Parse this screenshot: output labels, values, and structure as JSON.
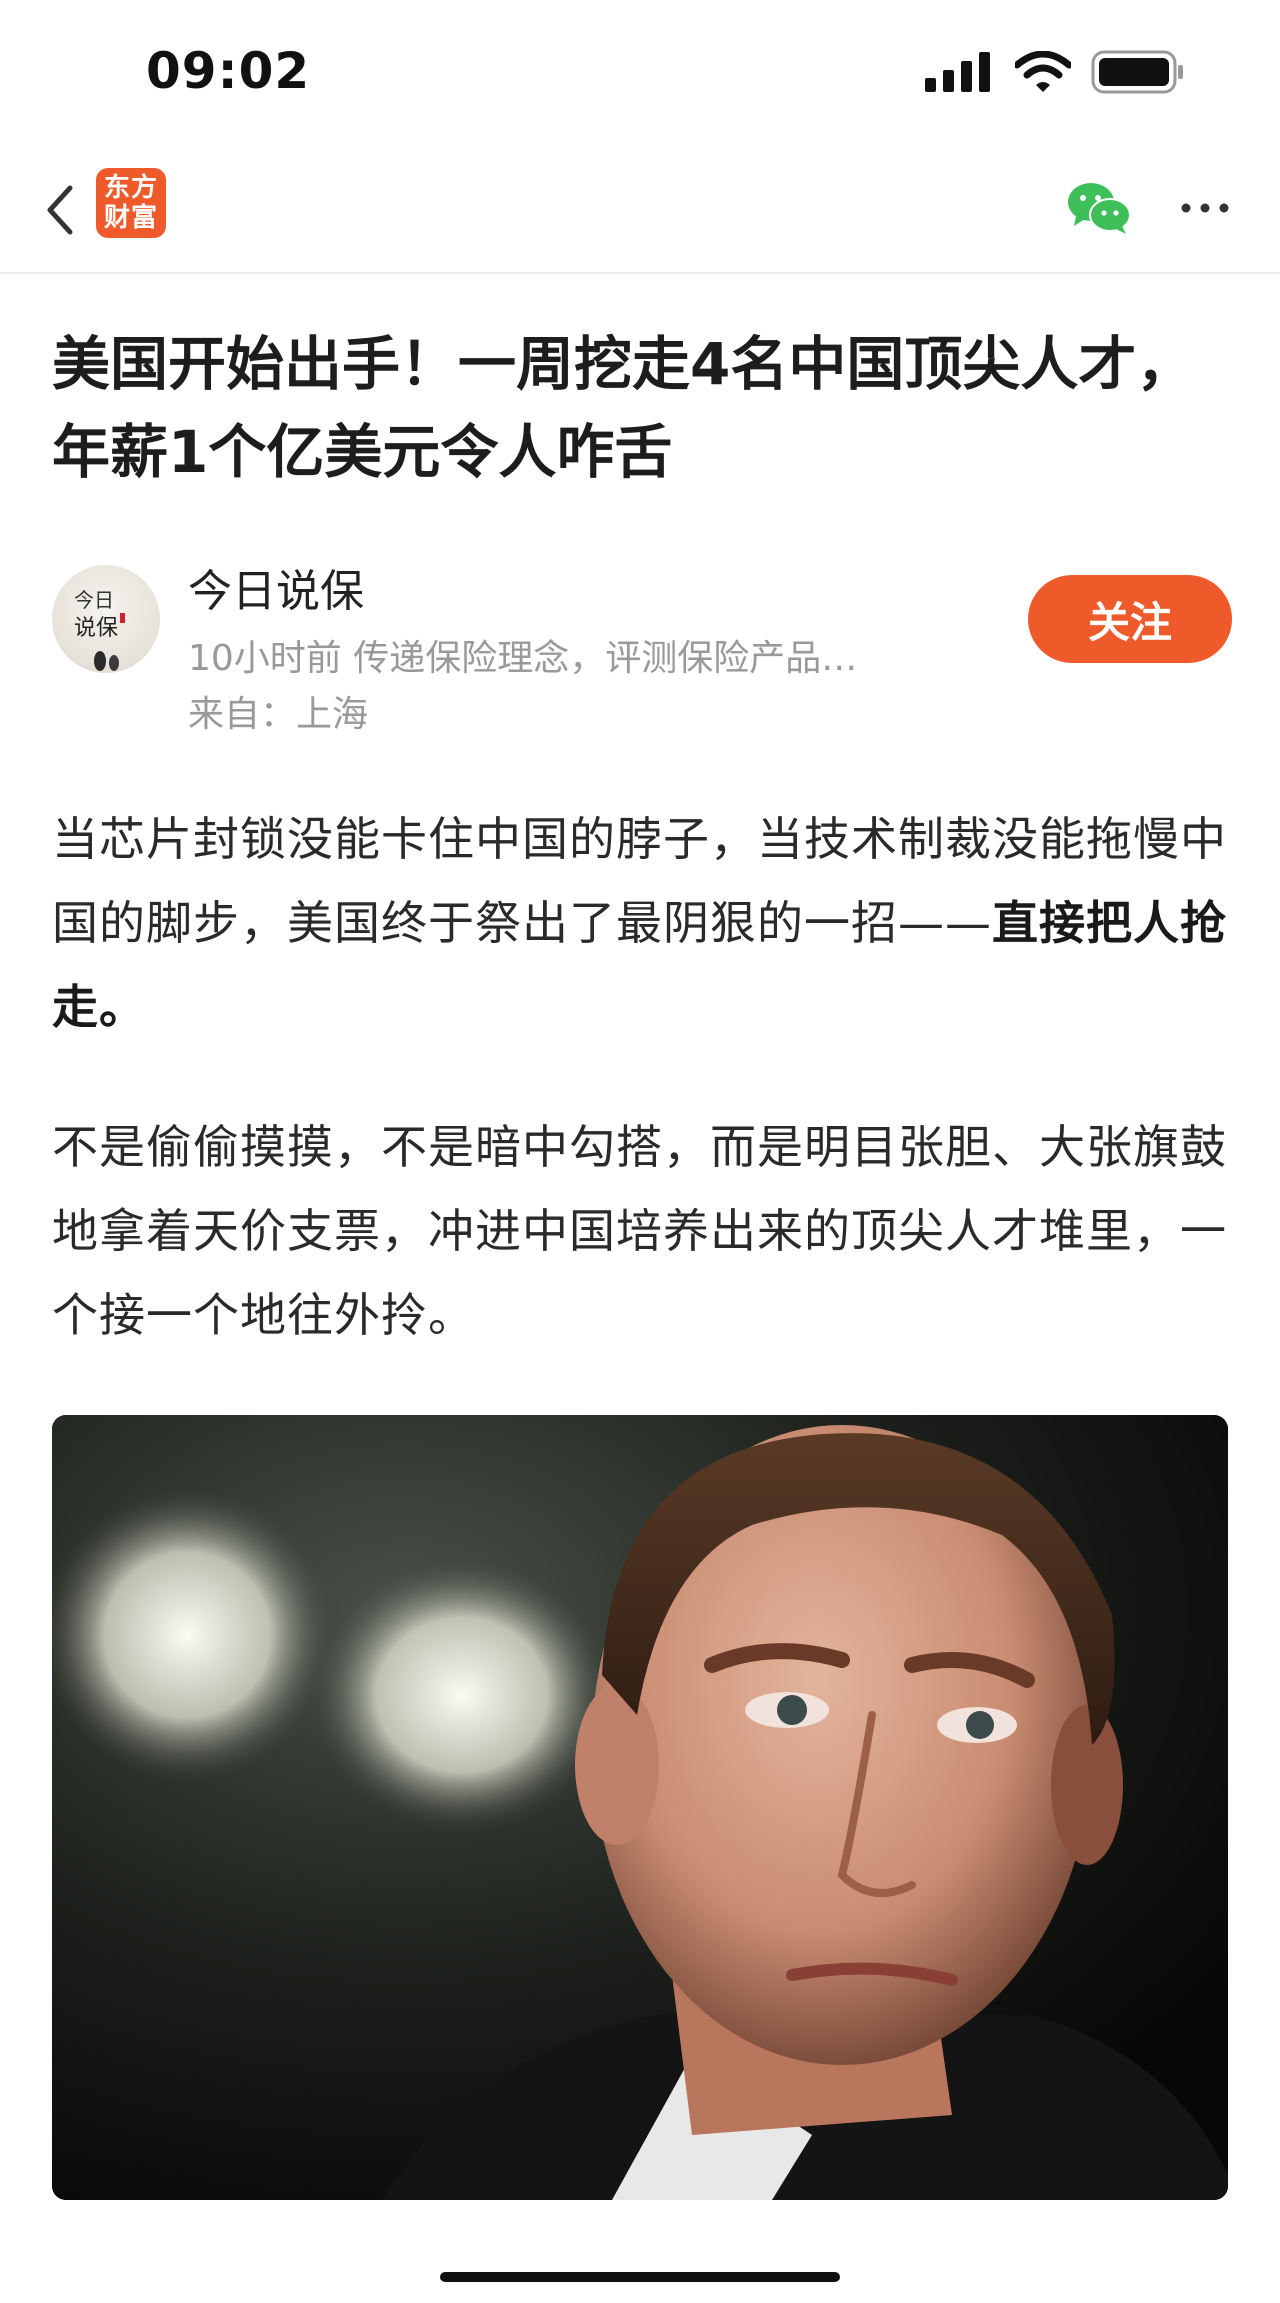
{
  "status_bar": {
    "time": "09:02"
  },
  "nav": {
    "app_logo_line1": "东方",
    "app_logo_line2": "财富",
    "share_icon": "wechat-icon",
    "more_icon": "more-icon"
  },
  "article": {
    "title": "美国开始出手！一周挖走4名中国顶尖人才，年薪1个亿美元令人咋舌",
    "author": {
      "name": "今日说保",
      "meta": "10小时前 传递保险理念，评测保险产品…",
      "location": "来自：上海",
      "avatar_text_1": "今日",
      "avatar_text_2": "说保",
      "follow_label": "关注"
    },
    "paragraph1_normal": "当芯片封锁没能卡住中国的脖子，当技术制裁没能拖慢中国的脚步，美国终于祭出了最阴狠的一招——",
    "paragraph1_bold": "直接把人抢走。",
    "paragraph2": "不是偷偷摸摸，不是暗中勾搭，而是明目张胆、大张旗鼓地拿着天价支票，冲进中国培养出来的顶尖人才堆里，一个接一个地往外拎。"
  },
  "colors": {
    "accent": "#ee5a2a",
    "wechat_green": "#3fbf5a"
  }
}
